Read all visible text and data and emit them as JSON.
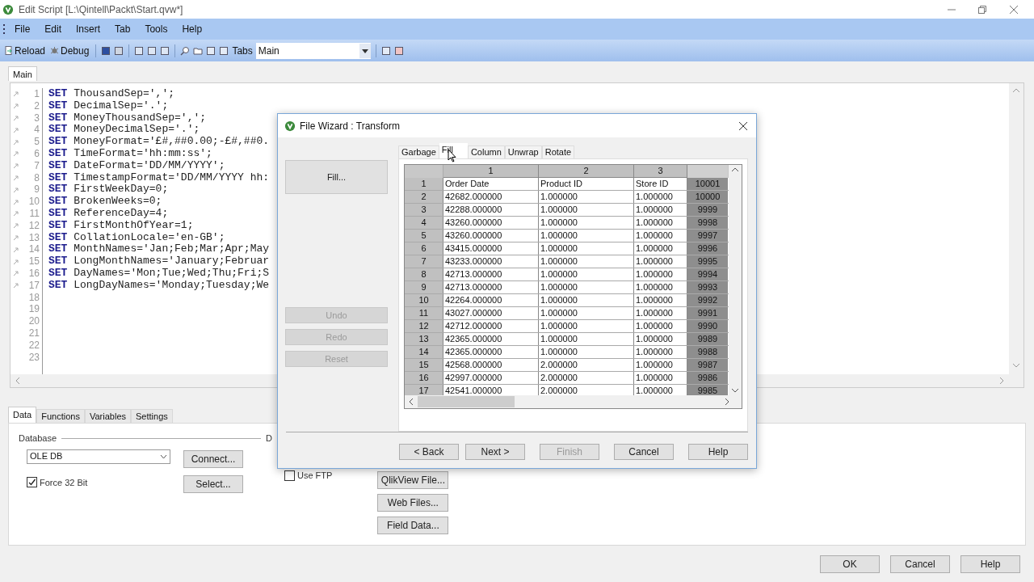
{
  "window": {
    "title": "Edit Script [L:\\Qintell\\Packt\\Start.qvw*]"
  },
  "menu": [
    "File",
    "Edit",
    "Insert",
    "Tab",
    "Tools",
    "Help"
  ],
  "toolbar": {
    "buttons": [
      {
        "label": "Reload",
        "kind": "reload"
      },
      {
        "label": "Debug",
        "kind": "debug"
      }
    ],
    "tabs_label": "Tabs",
    "tab_select": "Main"
  },
  "script_tabs": [
    {
      "label": "Main",
      "selected": true
    }
  ],
  "editor": {
    "lines": [
      {
        "number": "1",
        "keyword": "SET",
        "text": "ThousandSep=',';"
      },
      {
        "number": "2",
        "keyword": "SET",
        "text": "DecimalSep='.';"
      },
      {
        "number": "3",
        "keyword": "SET",
        "text": "MoneyThousandSep=',';"
      },
      {
        "number": "4",
        "keyword": "SET",
        "text": "MoneyDecimalSep='.';"
      },
      {
        "number": "5",
        "keyword": "SET",
        "text": "MoneyFormat='£#,##0.00;-£#,##0."
      },
      {
        "number": "6",
        "keyword": "SET",
        "text": "TimeFormat='hh:mm:ss';"
      },
      {
        "number": "7",
        "keyword": "SET",
        "text": "DateFormat='DD/MM/YYYY';"
      },
      {
        "number": "8",
        "keyword": "SET",
        "text": "TimestampFormat='DD/MM/YYYY hh:"
      },
      {
        "number": "9",
        "keyword": "SET",
        "text": "FirstWeekDay=0;"
      },
      {
        "number": "10",
        "keyword": "SET",
        "text": "BrokenWeeks=0;"
      },
      {
        "number": "11",
        "keyword": "SET",
        "text": "ReferenceDay=4;"
      },
      {
        "number": "12",
        "keyword": "SET",
        "text": "FirstMonthOfYear=1;"
      },
      {
        "number": "13",
        "keyword": "SET",
        "text": "CollationLocale='en-GB';"
      },
      {
        "number": "14",
        "keyword": "SET",
        "text": "MonthNames='Jan;Feb;Mar;Apr;May"
      },
      {
        "number": "15",
        "keyword": "SET",
        "text": "LongMonthNames='January;Februar"
      },
      {
        "number": "16",
        "keyword": "SET",
        "text": "DayNames='Mon;Tue;Wed;Thu;Fri;S"
      },
      {
        "number": "17",
        "keyword": "SET",
        "text": "LongDayNames='Monday;Tuesday;We"
      },
      {
        "number": "18"
      },
      {
        "number": "19"
      },
      {
        "number": "20"
      },
      {
        "number": "21"
      },
      {
        "number": "22"
      },
      {
        "number": "23"
      }
    ]
  },
  "bottom_tabs": [
    {
      "label": "Data",
      "selected": true
    },
    {
      "label": "Functions",
      "selected": false
    },
    {
      "label": "Variables",
      "selected": false
    },
    {
      "label": "Settings",
      "selected": false
    }
  ],
  "database": {
    "group_label": "Database",
    "select": "OLE DB",
    "force32": {
      "label": "Force 32 Bit",
      "checked": true
    },
    "buttons": [
      "Connect...",
      "Select..."
    ]
  },
  "second_group": {
    "label": "D",
    "use_ftp": {
      "label": "Use FTP",
      "checked": false
    },
    "buttons": [
      "QlikView File...",
      "Web Files...",
      "Field Data..."
    ]
  },
  "dialog_buttons": [
    "OK",
    "Cancel",
    "Help"
  ],
  "wizard": {
    "title": "File Wizard : Transform",
    "side_buttons": [
      {
        "label": "Fill...",
        "disabled": false
      },
      {
        "label": "Undo",
        "disabled": true
      },
      {
        "label": "Redo",
        "disabled": true
      },
      {
        "label": "Reset",
        "disabled": true
      }
    ],
    "tabs": [
      {
        "label": "Garbage",
        "selected": false
      },
      {
        "label": "Fill",
        "selected": true
      },
      {
        "label": "Column",
        "selected": false
      },
      {
        "label": "Unwrap",
        "selected": false
      },
      {
        "label": "Rotate",
        "selected": false
      }
    ],
    "columns": [
      "1",
      "2",
      "3"
    ],
    "rows": [
      {
        "header": "1",
        "cells": [
          "Order Date",
          "Product ID",
          "Store ID"
        ],
        "extra": "10001"
      },
      {
        "header": "2",
        "cells": [
          "42682.000000",
          "1.000000",
          "1.000000"
        ],
        "extra": "10000"
      },
      {
        "header": "3",
        "cells": [
          "42288.000000",
          "1.000000",
          "1.000000"
        ],
        "extra": "9999"
      },
      {
        "header": "4",
        "cells": [
          "43260.000000",
          "1.000000",
          "1.000000"
        ],
        "extra": "9998"
      },
      {
        "header": "5",
        "cells": [
          "43260.000000",
          "1.000000",
          "1.000000"
        ],
        "extra": "9997"
      },
      {
        "header": "6",
        "cells": [
          "43415.000000",
          "1.000000",
          "1.000000"
        ],
        "extra": "9996"
      },
      {
        "header": "7",
        "cells": [
          "43233.000000",
          "1.000000",
          "1.000000"
        ],
        "extra": "9995"
      },
      {
        "header": "8",
        "cells": [
          "42713.000000",
          "1.000000",
          "1.000000"
        ],
        "extra": "9994"
      },
      {
        "header": "9",
        "cells": [
          "42713.000000",
          "1.000000",
          "1.000000"
        ],
        "extra": "9993"
      },
      {
        "header": "10",
        "cells": [
          "42264.000000",
          "1.000000",
          "1.000000"
        ],
        "extra": "9992"
      },
      {
        "header": "11",
        "cells": [
          "43027.000000",
          "1.000000",
          "1.000000"
        ],
        "extra": "9991"
      },
      {
        "header": "12",
        "cells": [
          "42712.000000",
          "1.000000",
          "1.000000"
        ],
        "extra": "9990"
      },
      {
        "header": "13",
        "cells": [
          "42365.000000",
          "1.000000",
          "1.000000"
        ],
        "extra": "9989"
      },
      {
        "header": "14",
        "cells": [
          "42365.000000",
          "1.000000",
          "1.000000"
        ],
        "extra": "9988"
      },
      {
        "header": "15",
        "cells": [
          "42568.000000",
          "2.000000",
          "1.000000"
        ],
        "extra": "9987"
      },
      {
        "header": "16",
        "cells": [
          "42997.000000",
          "2.000000",
          "1.000000"
        ],
        "extra": "9986"
      },
      {
        "header": "17",
        "cells": [
          "42541.000000",
          "2.000000",
          "1.000000"
        ],
        "extra": "9985"
      }
    ],
    "footer_buttons": [
      {
        "label": "< Back",
        "disabled": false
      },
      {
        "label": "Next >",
        "disabled": false
      },
      {
        "label": "Finish",
        "disabled": true
      },
      {
        "label": "Cancel",
        "disabled": false
      },
      {
        "label": "Help",
        "disabled": false
      }
    ]
  }
}
